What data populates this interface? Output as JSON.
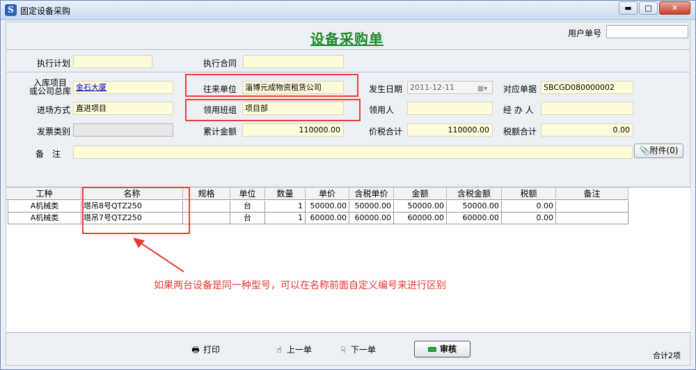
{
  "window": {
    "title": "固定设备采购",
    "icon": "S",
    "min": "▬",
    "max": "□",
    "close": "✕"
  },
  "form": {
    "title": "设备采购单",
    "user_no_label": "用户单号",
    "user_no_value": "",
    "exec_plan_label": "执行计划",
    "exec_plan_value": "",
    "exec_contract_label": "执行合同",
    "exec_contract_value": "",
    "storage_project_label_1": "入库项目",
    "storage_project_label_2": "或公司总库",
    "storage_project_value": "金石大厦",
    "partner_label": "往来单位",
    "partner_value": "淄博元成物资租赁公司",
    "date_label": "发生日期",
    "date_value": "2011-12-11",
    "ref_doc_label": "对应单据",
    "ref_doc_value": "SBCGD080000002",
    "entry_mode_label": "进场方式",
    "entry_mode_value": "直进项目",
    "team_label": "领用班组",
    "team_value": "项目部",
    "receiver_label": "领用人",
    "receiver_value": "",
    "handler_label": "经 办 人",
    "handler_value": "",
    "invoice_type_label": "发票类别",
    "invoice_type_value": "",
    "total_amount_label": "累计金额",
    "total_amount_value": "110000.00",
    "tax_total_label": "价税合计",
    "tax_total_value": "110000.00",
    "tax_sum_label": "税额合计",
    "tax_sum_value": "0.00",
    "remark_label": "备　注",
    "remark_value": "",
    "attach_label": "附件(0)"
  },
  "table": {
    "columns": [
      "工种",
      "名称",
      "规格",
      "单位",
      "数量",
      "单价",
      "含税单价",
      "金额",
      "含税金额",
      "税额",
      "备注"
    ],
    "rows": [
      [
        "A机械类",
        "塔吊8号QTZ250",
        "",
        "台",
        "1",
        "50000.00",
        "50000.00",
        "50000.00",
        "50000.00",
        "0.00",
        ""
      ],
      [
        "A机械类",
        "塔吊7号QTZ250",
        "",
        "台",
        "1",
        "60000.00",
        "60000.00",
        "60000.00",
        "60000.00",
        "0.00",
        ""
      ]
    ]
  },
  "annotation": "如果两台设备是同一种型号，可以在名称前面自定义编号来进行区别",
  "toolbar": {
    "print_label": "打印",
    "prev_label": "上一单",
    "next_label": "下一单",
    "audit_label": "审核"
  },
  "status": {
    "total_items": "合计2项"
  },
  "colors": {
    "title_green": "#1e8a2a",
    "annotation_red": "#e53a33",
    "field_yellow": "#fdfbd8"
  }
}
